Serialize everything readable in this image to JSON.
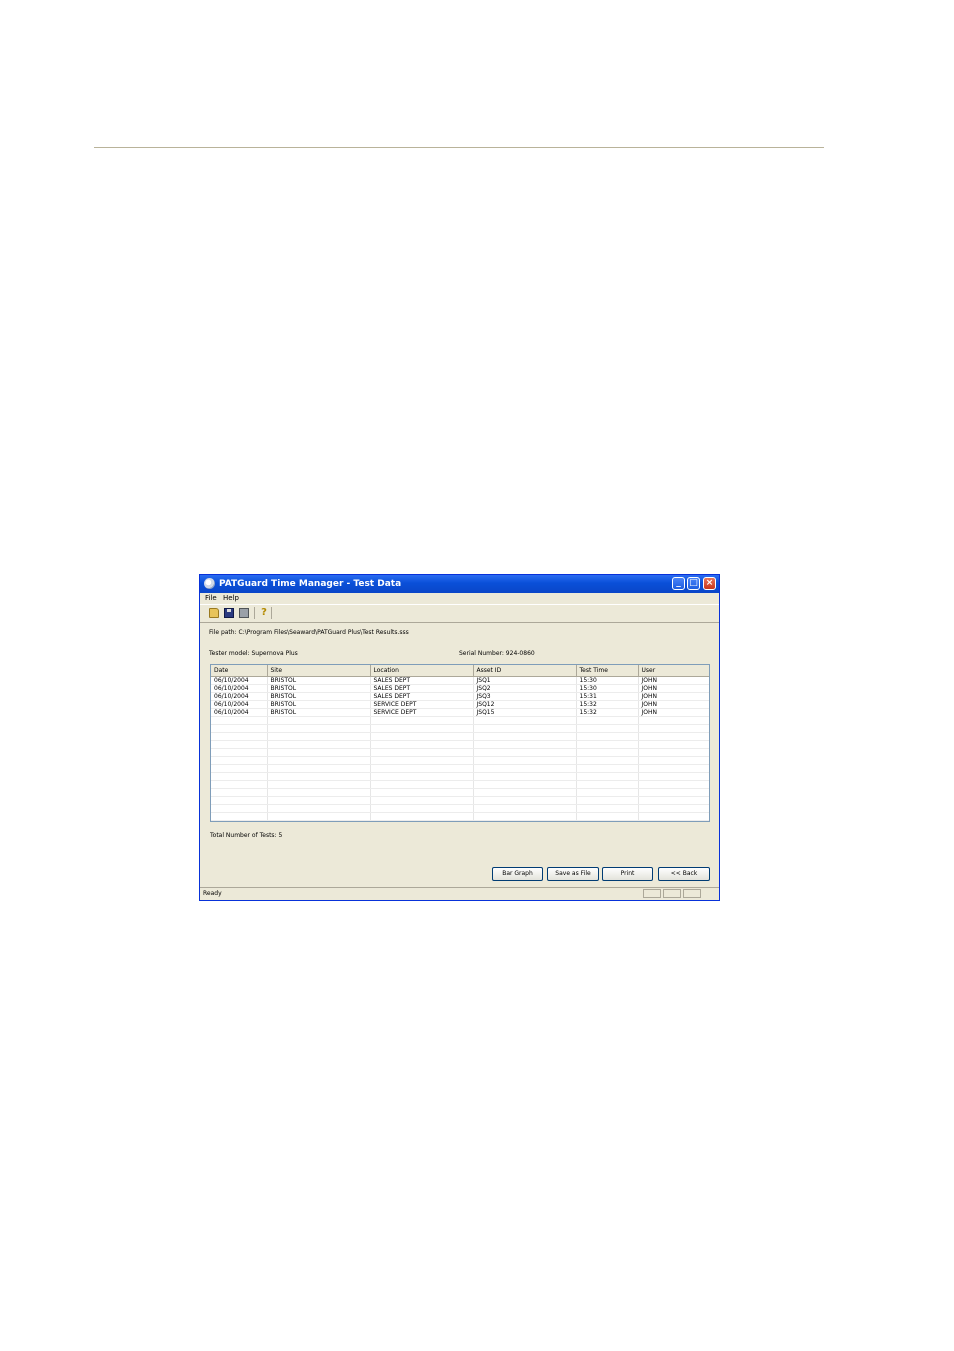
{
  "window": {
    "title": "PATGuard Time Manager - Test Data",
    "colors": {
      "titlebar": "#0a4fd8",
      "face": "#ece9d8",
      "border": "#0831d9"
    }
  },
  "menu": {
    "file": "File",
    "help": "Help"
  },
  "toolbar": {
    "icons": [
      "open-folder-icon",
      "save-disk-icon",
      "print-icon",
      "help-icon"
    ]
  },
  "info": {
    "file_path": "File path: C:\\Program Files\\Seaward\\PATGuard Plus\\Test Results.sss",
    "tester_model": "Tester model: Supernova Plus",
    "serial_number": "Serial Number: 924-0860"
  },
  "table": {
    "columns": [
      "Date",
      "Site",
      "Location",
      "Asset ID",
      "Test Time",
      "User"
    ],
    "rows": [
      [
        "06/10/2004",
        "BRISTOL",
        "SALES DEPT",
        "JSQ1",
        "15:30",
        "JOHN"
      ],
      [
        "06/10/2004",
        "BRISTOL",
        "SALES DEPT",
        "JSQ2",
        "15:30",
        "JOHN"
      ],
      [
        "06/10/2004",
        "BRISTOL",
        "SALES DEPT",
        "JSQ3",
        "15:31",
        "JOHN"
      ],
      [
        "06/10/2004",
        "BRISTOL",
        "SERVICE DEPT",
        "JSQ12",
        "15:32",
        "JOHN"
      ],
      [
        "06/10/2004",
        "BRISTOL",
        "SERVICE DEPT",
        "JSQ15",
        "15:32",
        "JOHN"
      ]
    ]
  },
  "total_tests": "Total Number of Tests: 5",
  "buttons": {
    "bar_graph": "Bar Graph",
    "save_as_file": "Save as File",
    "print": "Print",
    "back": "<< Back"
  },
  "status": {
    "text": "Ready"
  }
}
